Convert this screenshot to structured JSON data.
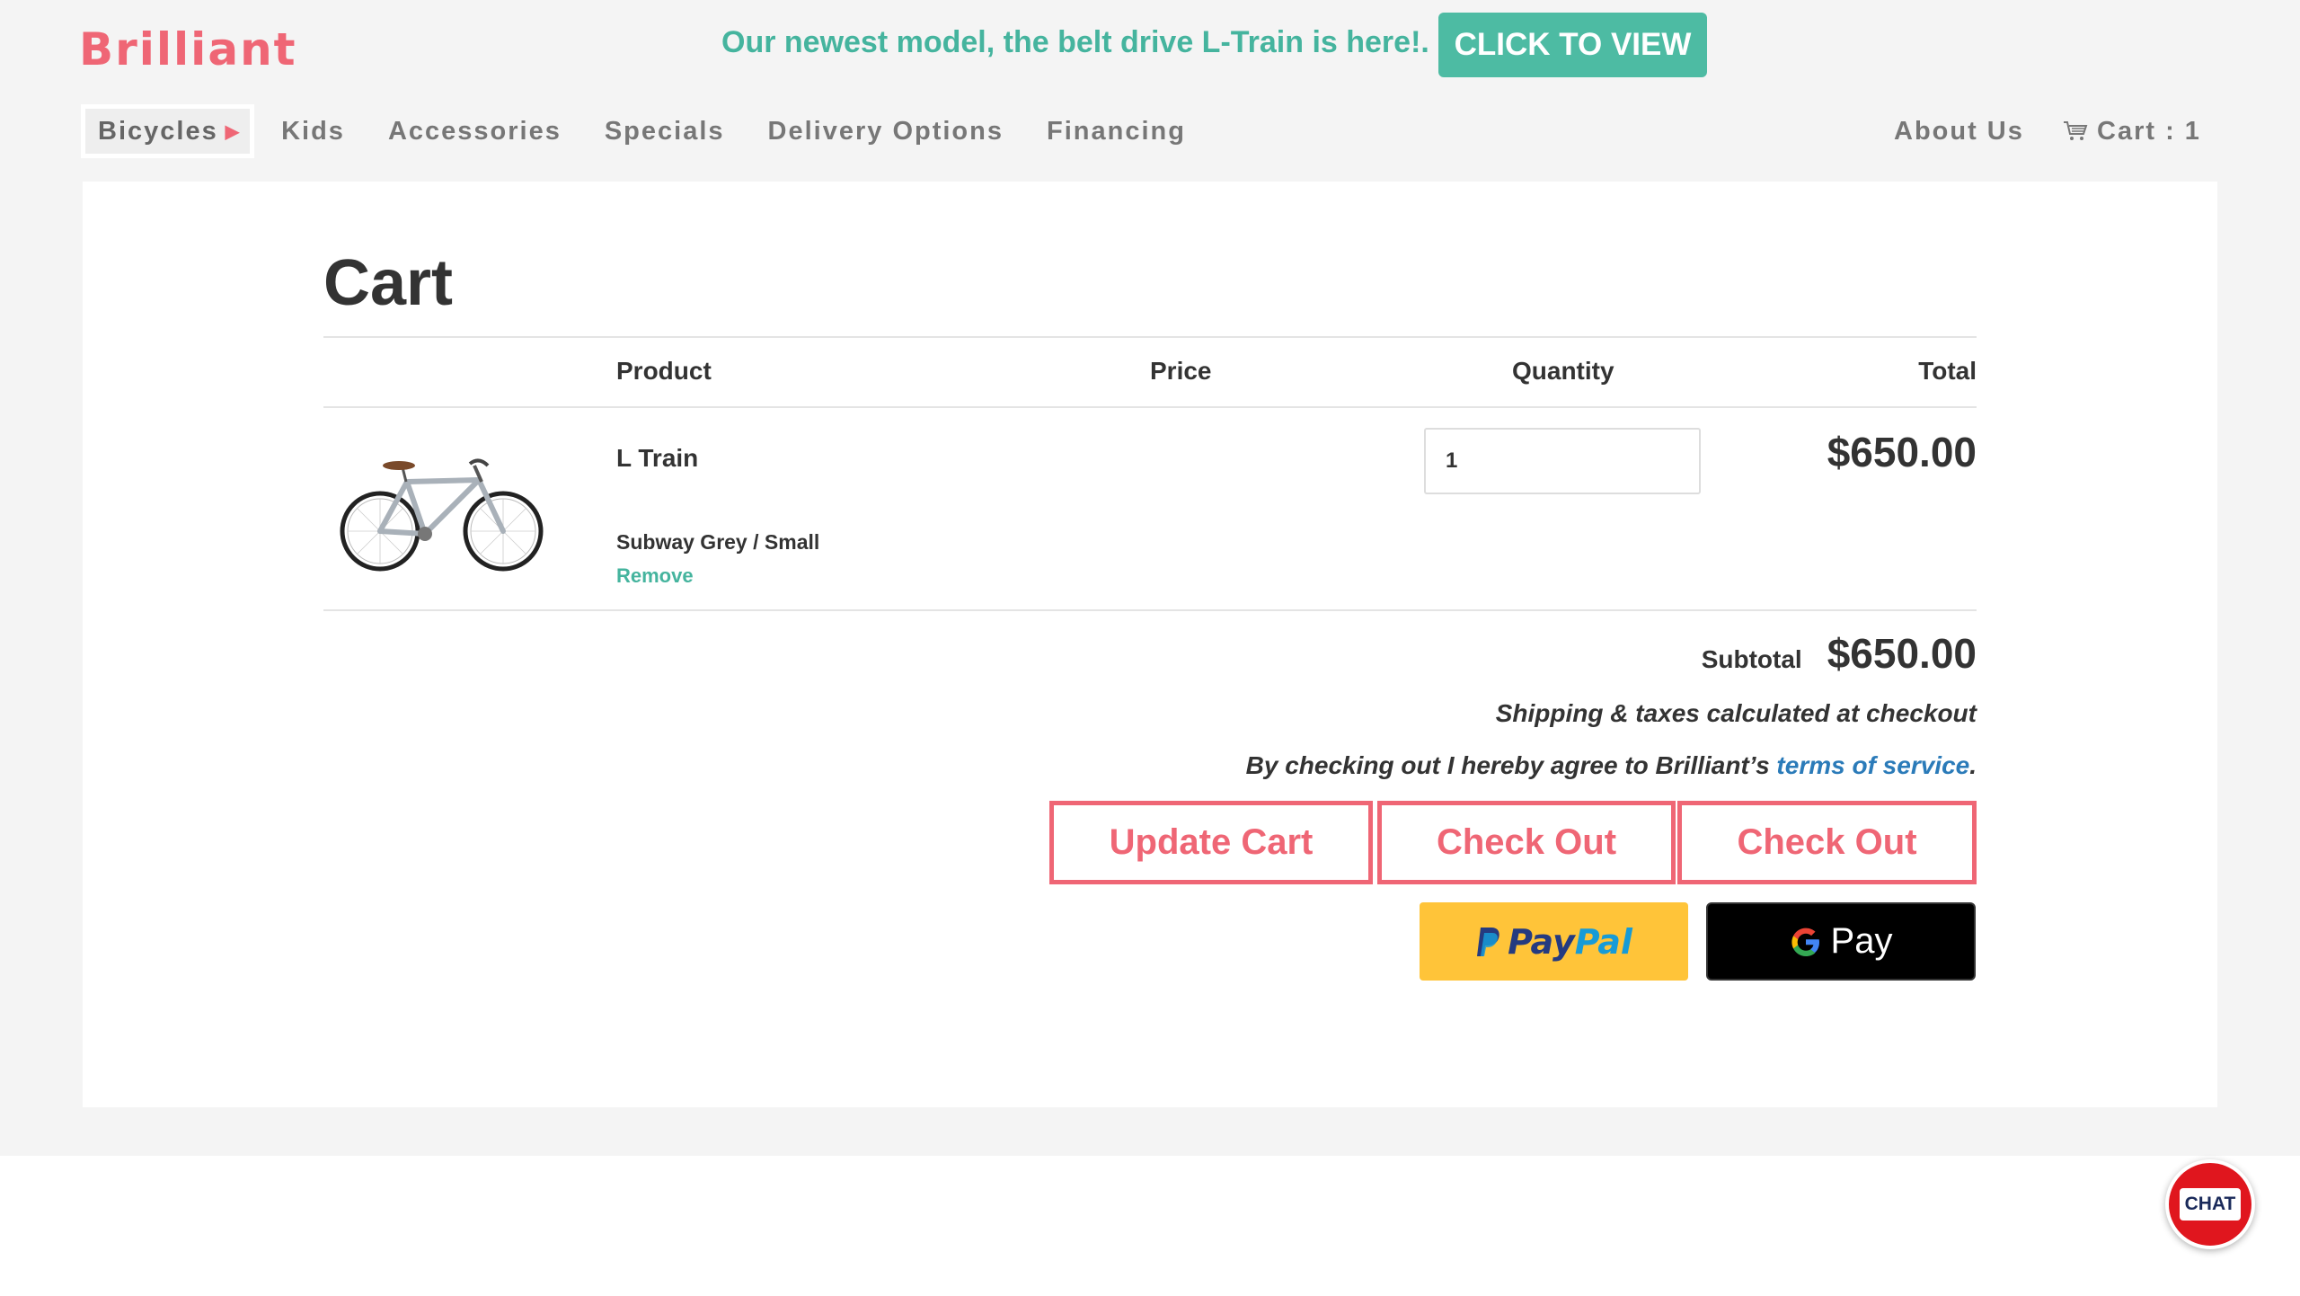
{
  "brand": {
    "logo": "Brilliant",
    "accent_color": "#ef6675",
    "teal_color": "#45b49e"
  },
  "announcement": {
    "text": "Our newest model, the belt drive L-Train is here!.",
    "cta_label": "CLICK TO VIEW"
  },
  "nav": {
    "items": [
      {
        "label": "Bicycles",
        "active": true
      },
      {
        "label": "Kids"
      },
      {
        "label": "Accessories"
      },
      {
        "label": "Specials"
      },
      {
        "label": "Delivery Options"
      },
      {
        "label": "Financing"
      }
    ],
    "about_label": "About Us",
    "cart_label": "Cart : 1"
  },
  "cart": {
    "title": "Cart",
    "columns": {
      "product": "Product",
      "price": "Price",
      "quantity": "Quantity",
      "total": "Total"
    },
    "items": [
      {
        "name": "L Train",
        "variant": "Subway Grey / Small",
        "remove_label": "Remove",
        "quantity": "1",
        "total": "$650.00",
        "image": "bicycle-photo"
      }
    ],
    "subtotal_label": "Subtotal",
    "subtotal_value": "$650.00",
    "shipping_note": "Shipping & taxes calculated at checkout",
    "terms_prefix": "By checking out I hereby agree to Brilliant’s ",
    "terms_link": "terms of service",
    "terms_suffix": ".",
    "update_label": "Update Cart",
    "checkout_label": "Check Out",
    "checkout_label_2": "Check Out",
    "paypal": {
      "pay": "Pay",
      "pal": "Pal",
      "color": "#ffc439"
    },
    "gpay_label": "Pay"
  },
  "chat": {
    "label": "CHAT",
    "color": "#e0161e"
  }
}
